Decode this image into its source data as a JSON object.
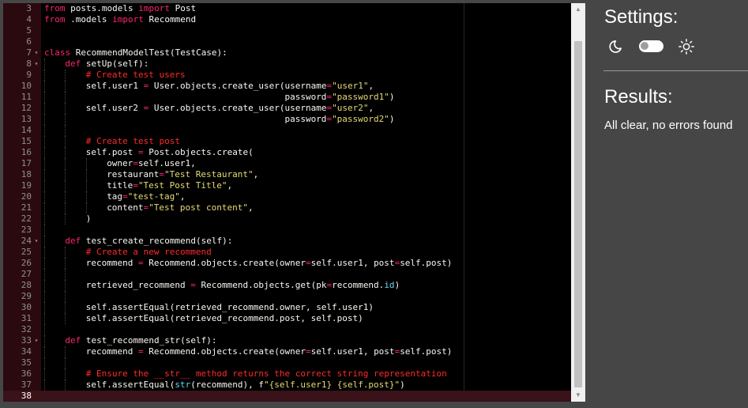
{
  "editor": {
    "lines": [
      {
        "n": "3",
        "fold": "",
        "active": false,
        "indent": 0,
        "tokens": [
          {
            "t": "from",
            "c": "kw"
          },
          {
            "t": " posts.models "
          },
          {
            "t": "import",
            "c": "kw"
          },
          {
            "t": " Post"
          }
        ]
      },
      {
        "n": "4",
        "fold": "",
        "active": false,
        "indent": 0,
        "tokens": [
          {
            "t": "from",
            "c": "kw"
          },
          {
            "t": " .models "
          },
          {
            "t": "import",
            "c": "kw"
          },
          {
            "t": " Recommend"
          }
        ]
      },
      {
        "n": "5",
        "fold": "",
        "active": false,
        "indent": 0,
        "tokens": []
      },
      {
        "n": "6",
        "fold": "",
        "active": false,
        "indent": 0,
        "tokens": []
      },
      {
        "n": "7",
        "fold": "▾",
        "active": false,
        "indent": 0,
        "tokens": [
          {
            "t": "class",
            "c": "kw"
          },
          {
            "t": " RecommendModelTest(TestCase):"
          }
        ]
      },
      {
        "n": "8",
        "fold": "▾",
        "active": false,
        "indent": 1,
        "tokens": [
          {
            "t": "def",
            "c": "kw"
          },
          {
            "t": " setUp(self):"
          }
        ]
      },
      {
        "n": "9",
        "fold": "",
        "active": false,
        "indent": 2,
        "tokens": [
          {
            "t": "# Create test users",
            "c": "cm"
          }
        ]
      },
      {
        "n": "10",
        "fold": "",
        "active": false,
        "indent": 2,
        "tokens": [
          {
            "t": "self.user1 "
          },
          {
            "t": "=",
            "c": "kw"
          },
          {
            "t": " User.objects.create_user(username"
          },
          {
            "t": "=",
            "c": "kw"
          },
          {
            "t": "\"user1\"",
            "c": "st"
          },
          {
            "t": ","
          }
        ]
      },
      {
        "n": "11",
        "fold": "",
        "active": false,
        "indent": 2,
        "tokens": [
          {
            "t": "                                      password"
          },
          {
            "t": "=",
            "c": "kw"
          },
          {
            "t": "\"password1\"",
            "c": "st"
          },
          {
            "t": ")"
          }
        ]
      },
      {
        "n": "12",
        "fold": "",
        "active": false,
        "indent": 2,
        "tokens": [
          {
            "t": "self.user2 "
          },
          {
            "t": "=",
            "c": "kw"
          },
          {
            "t": " User.objects.create_user(username"
          },
          {
            "t": "=",
            "c": "kw"
          },
          {
            "t": "\"user2\"",
            "c": "st"
          },
          {
            "t": ","
          }
        ]
      },
      {
        "n": "13",
        "fold": "",
        "active": false,
        "indent": 2,
        "tokens": [
          {
            "t": "                                      password"
          },
          {
            "t": "=",
            "c": "kw"
          },
          {
            "t": "\"password2\"",
            "c": "st"
          },
          {
            "t": ")"
          }
        ]
      },
      {
        "n": "14",
        "fold": "",
        "active": false,
        "indent": 2,
        "tokens": []
      },
      {
        "n": "15",
        "fold": "",
        "active": false,
        "indent": 2,
        "tokens": [
          {
            "t": "# Create test post",
            "c": "cm"
          }
        ]
      },
      {
        "n": "16",
        "fold": "",
        "active": false,
        "indent": 2,
        "tokens": [
          {
            "t": "self.post "
          },
          {
            "t": "=",
            "c": "kw"
          },
          {
            "t": " Post.objects.create("
          }
        ]
      },
      {
        "n": "17",
        "fold": "",
        "active": false,
        "indent": 3,
        "tokens": [
          {
            "t": "owner"
          },
          {
            "t": "=",
            "c": "kw"
          },
          {
            "t": "self.user1,"
          }
        ]
      },
      {
        "n": "18",
        "fold": "",
        "active": false,
        "indent": 3,
        "tokens": [
          {
            "t": "restaurant"
          },
          {
            "t": "=",
            "c": "kw"
          },
          {
            "t": "\"Test Restaurant\"",
            "c": "st"
          },
          {
            "t": ","
          }
        ]
      },
      {
        "n": "19",
        "fold": "",
        "active": false,
        "indent": 3,
        "tokens": [
          {
            "t": "title"
          },
          {
            "t": "=",
            "c": "kw"
          },
          {
            "t": "\"Test Post Title\"",
            "c": "st"
          },
          {
            "t": ","
          }
        ]
      },
      {
        "n": "20",
        "fold": "",
        "active": false,
        "indent": 3,
        "tokens": [
          {
            "t": "tag"
          },
          {
            "t": "=",
            "c": "kw"
          },
          {
            "t": "\"test-tag\"",
            "c": "st"
          },
          {
            "t": ","
          }
        ]
      },
      {
        "n": "21",
        "fold": "",
        "active": false,
        "indent": 3,
        "tokens": [
          {
            "t": "content"
          },
          {
            "t": "=",
            "c": "kw"
          },
          {
            "t": "\"Test post content\"",
            "c": "st"
          },
          {
            "t": ","
          }
        ]
      },
      {
        "n": "22",
        "fold": "",
        "active": false,
        "indent": 2,
        "tokens": [
          {
            "t": ")"
          }
        ]
      },
      {
        "n": "23",
        "fold": "",
        "active": false,
        "indent": 1,
        "tokens": []
      },
      {
        "n": "24",
        "fold": "▾",
        "active": false,
        "indent": 1,
        "tokens": [
          {
            "t": "def",
            "c": "kw"
          },
          {
            "t": " test_create_recommend(self):"
          }
        ]
      },
      {
        "n": "25",
        "fold": "",
        "active": false,
        "indent": 2,
        "tokens": [
          {
            "t": "# Create a new recommend",
            "c": "cm"
          }
        ]
      },
      {
        "n": "26",
        "fold": "",
        "active": false,
        "indent": 2,
        "tokens": [
          {
            "t": "recommend "
          },
          {
            "t": "=",
            "c": "kw"
          },
          {
            "t": " Recommend.objects.create(owner"
          },
          {
            "t": "=",
            "c": "kw"
          },
          {
            "t": "self.user1, post"
          },
          {
            "t": "=",
            "c": "kw"
          },
          {
            "t": "self.post)"
          }
        ]
      },
      {
        "n": "27",
        "fold": "",
        "active": false,
        "indent": 2,
        "tokens": []
      },
      {
        "n": "28",
        "fold": "",
        "active": false,
        "indent": 2,
        "tokens": [
          {
            "t": "retrieved_recommend "
          },
          {
            "t": "=",
            "c": "kw"
          },
          {
            "t": " Recommend.objects.get(pk"
          },
          {
            "t": "=",
            "c": "kw"
          },
          {
            "t": "recommend."
          },
          {
            "t": "id",
            "c": "bi"
          },
          {
            "t": ")"
          }
        ]
      },
      {
        "n": "29",
        "fold": "",
        "active": false,
        "indent": 2,
        "tokens": []
      },
      {
        "n": "30",
        "fold": "",
        "active": false,
        "indent": 2,
        "tokens": [
          {
            "t": "self.assertEqual(retrieved_recommend.owner, self.user1)"
          }
        ]
      },
      {
        "n": "31",
        "fold": "",
        "active": false,
        "indent": 2,
        "tokens": [
          {
            "t": "self.assertEqual(retrieved_recommend.post, self.post)"
          }
        ]
      },
      {
        "n": "32",
        "fold": "",
        "active": false,
        "indent": 1,
        "tokens": []
      },
      {
        "n": "33",
        "fold": "▾",
        "active": false,
        "indent": 1,
        "tokens": [
          {
            "t": "def",
            "c": "kw"
          },
          {
            "t": " test_recommend_str(self):"
          }
        ]
      },
      {
        "n": "34",
        "fold": "",
        "active": false,
        "indent": 2,
        "tokens": [
          {
            "t": "recommend "
          },
          {
            "t": "=",
            "c": "kw"
          },
          {
            "t": " Recommend.objects.create(owner"
          },
          {
            "t": "=",
            "c": "kw"
          },
          {
            "t": "self.user1, post"
          },
          {
            "t": "=",
            "c": "kw"
          },
          {
            "t": "self.post)"
          }
        ]
      },
      {
        "n": "35",
        "fold": "",
        "active": false,
        "indent": 2,
        "tokens": []
      },
      {
        "n": "36",
        "fold": "",
        "active": false,
        "indent": 2,
        "tokens": [
          {
            "t": "# Ensure the __str__ method returns the correct string representation",
            "c": "cm"
          }
        ]
      },
      {
        "n": "37",
        "fold": "",
        "active": false,
        "indent": 2,
        "tokens": [
          {
            "t": "self.assertEqual("
          },
          {
            "t": "str",
            "c": "bi"
          },
          {
            "t": "(recommend), f"
          },
          {
            "t": "\"{self.user1} {self.post}\"",
            "c": "st"
          },
          {
            "t": ")"
          }
        ]
      },
      {
        "n": "38",
        "fold": "",
        "active": true,
        "indent": 0,
        "tokens": []
      }
    ]
  },
  "scrollbar": {
    "up_glyph": "▲",
    "down_glyph": "▼"
  },
  "settings": {
    "title": "Settings:",
    "theme_toggle": {
      "left_icon": "moon-icon",
      "right_icon": "sun-icon",
      "state": "off"
    }
  },
  "results": {
    "title": "Results:",
    "message": "All clear, no errors found"
  },
  "colors": {
    "keyword": "#f92672",
    "string": "#e6db74",
    "comment": "#ff2a2a",
    "builtin": "#66d9ef",
    "panel_bg": "#464646"
  }
}
